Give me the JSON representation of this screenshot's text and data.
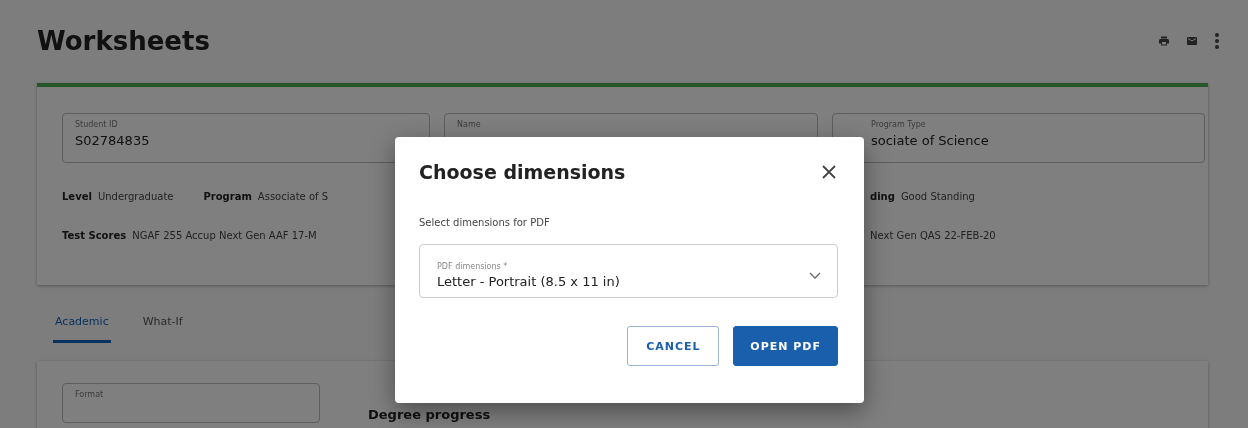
{
  "page": {
    "title": "Worksheets"
  },
  "summary": {
    "fields": [
      {
        "label": "Student ID",
        "value": "S02784835"
      },
      {
        "label": "Name"
      },
      {
        "label": "Program Type",
        "value": "sociate of Science"
      }
    ],
    "left_rows": [
      [
        {
          "label": "Level",
          "value": "Undergraduate"
        },
        {
          "label": "Program",
          "value": "Associate of S"
        }
      ],
      [
        {
          "label": "Test Scores",
          "value": "NGAF 255 Accup Next Gen AAF 17-M"
        }
      ]
    ],
    "right_rows": [
      [
        {
          "label": "ding",
          "value": "Good Standing"
        }
      ],
      [
        {
          "value": "Next Gen QAS 22-FEB-20"
        }
      ]
    ]
  },
  "tabs": [
    {
      "label": "Academic",
      "selected": true
    },
    {
      "label": "What-If",
      "selected": false
    }
  ],
  "detail": {
    "format_label": "Format",
    "heading": "Degree progress"
  },
  "dialog": {
    "title": "Choose dimensions",
    "description": "Select dimensions for PDF",
    "select": {
      "label": "PDF dimensions *",
      "value": "Letter - Portrait (8.5 x 11 in)"
    },
    "buttons": [
      {
        "label": "CANCEL",
        "kind": "secondary"
      },
      {
        "label": "OPEN PDF",
        "kind": "primary"
      }
    ]
  }
}
